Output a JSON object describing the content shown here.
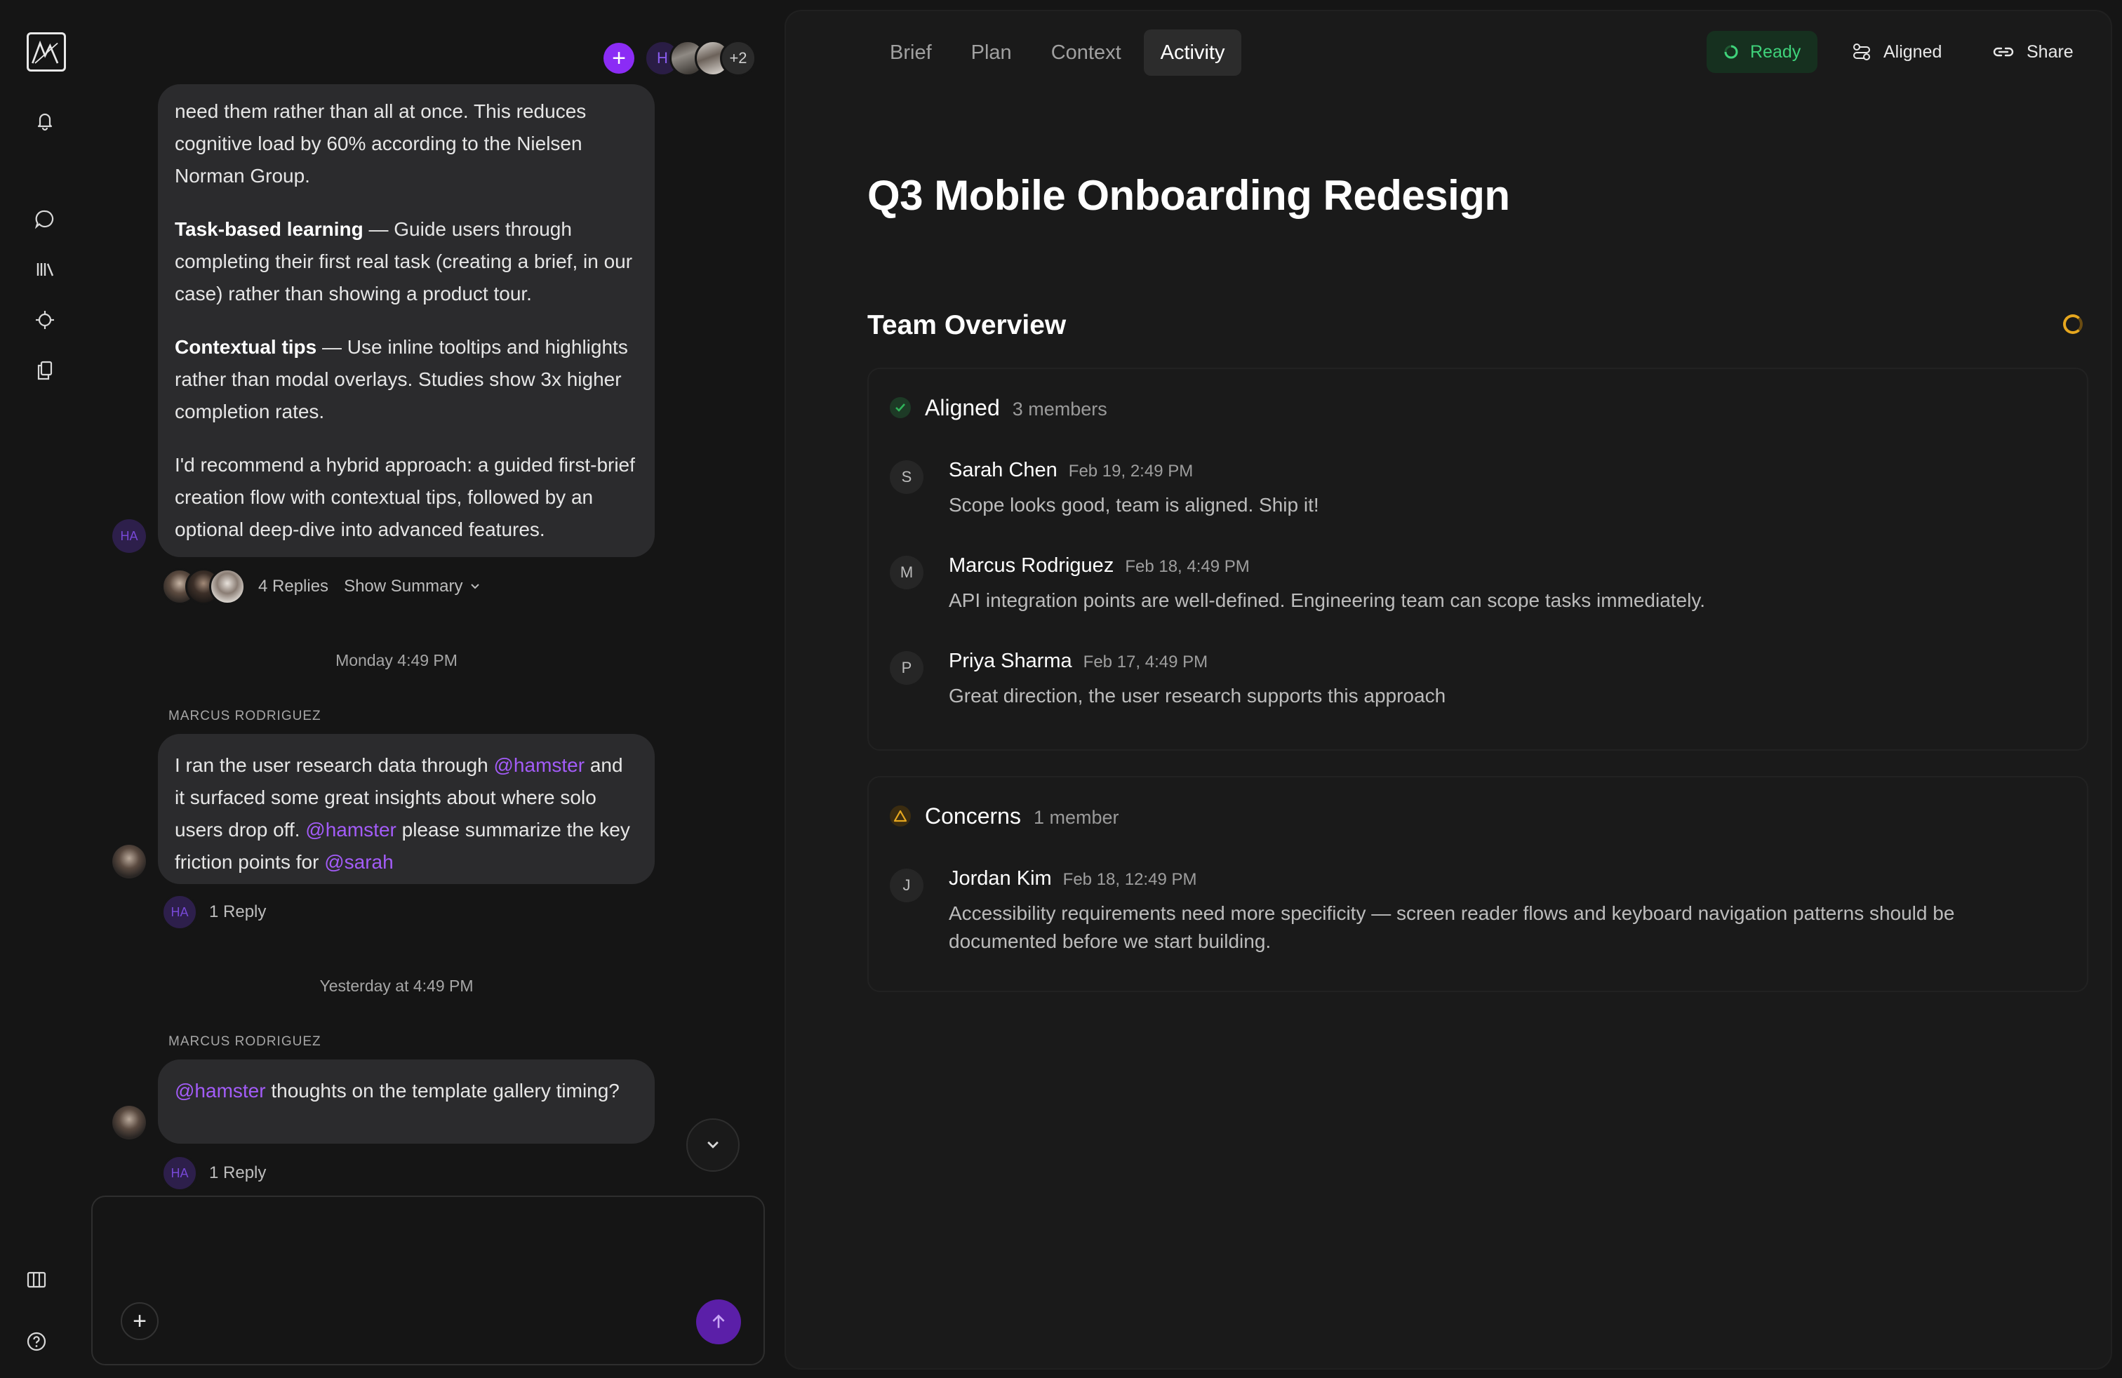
{
  "chat": {
    "header_avatars": [
      "H",
      "+2"
    ],
    "message1": {
      "author_initials": "HA",
      "p1": "need them rather than all at once. This reduces cognitive load by 60% according to the Nielsen Norman Group.",
      "p2_bold": "Task-based learning",
      "p2": " — Guide users through completing their first real task (creating a brief, in our case) rather than showing a product tour.",
      "p3_bold": "Contextual tips",
      "p3": " — Use inline tooltips and highlights rather than modal overlays. Studies show 3x higher completion rates.",
      "p4": "I'd recommend a hybrid approach: a guided first-brief creation flow with contextual tips, followed by an optional deep-dive into advanced features.",
      "replies": "4 Replies",
      "show_summary": "Show Summary"
    },
    "sep1": "Monday 4:49 PM",
    "message2": {
      "sender": "MARCUS RODRIGUEZ",
      "t1": "I ran the user research data through ",
      "m1": "@hamster",
      "t2": " and it surfaced some great insights about where solo users drop off. ",
      "m2": "@hamster",
      "t3": " please summarize the key friction points for ",
      "m3": "@sarah",
      "reply_avatar": "HA",
      "replies": "1 Reply"
    },
    "sep2": "Yesterday at 4:49 PM",
    "message3": {
      "sender": "MARCUS RODRIGUEZ",
      "m1": "@hamster",
      "t1": " thoughts on the template gallery timing?",
      "reply_avatar": "HA",
      "replies": "1 Reply"
    }
  },
  "doc": {
    "tabs": [
      "Brief",
      "Plan",
      "Context",
      "Activity"
    ],
    "active_tab": "Activity",
    "status": "Ready",
    "aligned_btn": "Aligned",
    "share_btn": "Share",
    "title": "Q3 Mobile Onboarding Redesign",
    "section": "Team Overview",
    "aligned_group": {
      "label": "Aligned",
      "count": "3 members",
      "members": [
        {
          "initial": "S",
          "name": "Sarah Chen",
          "time": "Feb 19, 2:49 PM",
          "text": "Scope looks good, team is aligned. Ship it!"
        },
        {
          "initial": "M",
          "name": "Marcus Rodriguez",
          "time": "Feb 18, 4:49 PM",
          "text": "API integration points are well-defined. Engineering team can scope tasks immediately."
        },
        {
          "initial": "P",
          "name": "Priya Sharma",
          "time": "Feb 17, 4:49 PM",
          "text": "Great direction, the user research supports this approach"
        }
      ]
    },
    "concerns_group": {
      "label": "Concerns",
      "count": "1 member",
      "members": [
        {
          "initial": "J",
          "name": "Jordan Kim",
          "time": "Feb 18, 12:49 PM",
          "text": "Accessibility requirements need more specificity — screen reader flows and keyboard navigation patterns should be documented before we start building."
        }
      ]
    }
  },
  "colors": {
    "accent": "#8b2cf5",
    "mention": "#a35cf8",
    "ready": "#3fd27a",
    "aligned": "#2fb35a",
    "concern": "#e6a71f"
  }
}
